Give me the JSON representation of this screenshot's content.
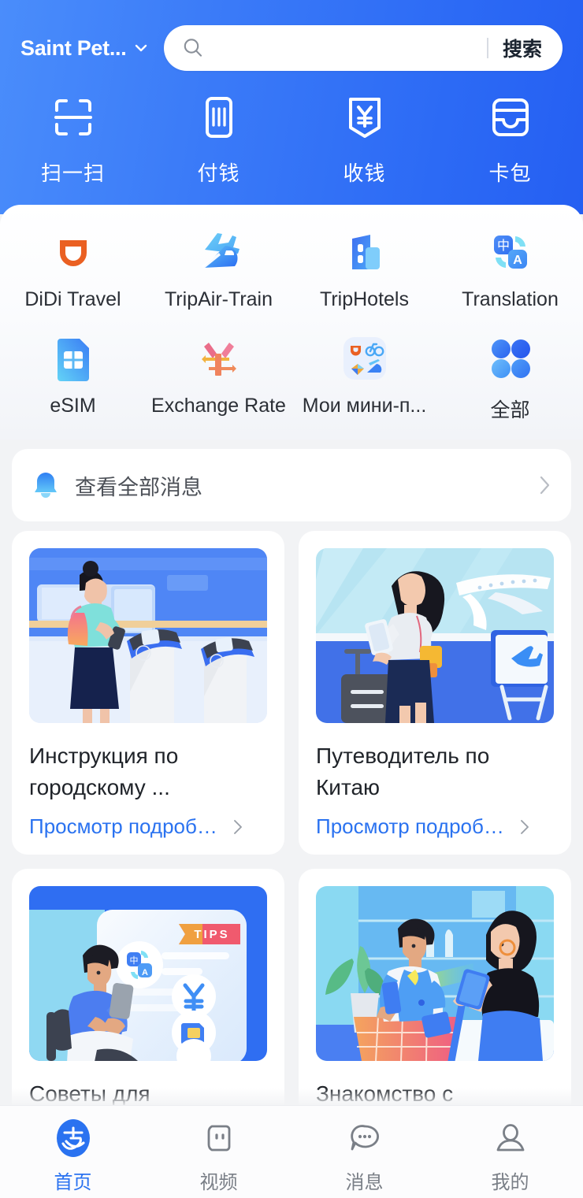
{
  "header": {
    "location": "Saint Pet...",
    "location_icon": "chevron-down-icon",
    "search": {
      "placeholder": "",
      "value": "",
      "icon": "search-icon",
      "button_label": "搜索"
    },
    "quick_actions": [
      {
        "label": "扫一扫",
        "icon": "scan-icon"
      },
      {
        "label": "付钱",
        "icon": "barcode-pay-icon"
      },
      {
        "label": "收钱",
        "icon": "receive-money-icon"
      },
      {
        "label": "卡包",
        "icon": "card-wallet-icon"
      }
    ]
  },
  "apps": {
    "row1": [
      {
        "label": "DiDi Travel",
        "icon": "didi-icon",
        "color": "#ea6022"
      },
      {
        "label": "TripAir-Train",
        "icon": "plane-train-icon",
        "color": "#3a8dfb"
      },
      {
        "label": "TripHotels",
        "icon": "hotel-building-icon",
        "color": "#3a7df5"
      },
      {
        "label": "Translation",
        "icon": "translate-icon",
        "color": "#3b8ef7"
      }
    ],
    "row2": [
      {
        "label": "eSIM",
        "icon": "sim-card-icon",
        "color": "#3d8ef8"
      },
      {
        "label": "Exchange Rate",
        "icon": "exchange-rate-icon",
        "color": "#ef7a6a"
      },
      {
        "label": "Мои мини-п...",
        "icon": "my-miniapps-icon",
        "color": "#e9f0fd"
      },
      {
        "label": "全部",
        "icon": "all-apps-grid-icon",
        "color": "#2f74f2"
      }
    ]
  },
  "notice": {
    "icon": "bell-icon",
    "text": "查看全部消息",
    "chevron": "chevron-right-icon"
  },
  "cards": [
    {
      "title": "Инструкция по городскому ...",
      "link_label": "Просмотр подробн...",
      "link_chevron": "chevron-right-icon",
      "illustration": "metro-gate-woman-phone"
    },
    {
      "title": "Путеводитель по Китаю",
      "link_label": "Просмотр подробн...",
      "link_chevron": "chevron-right-icon",
      "illustration": "airport-woman-suitcase-plane"
    },
    {
      "title": "Советы для",
      "link_label": "",
      "link_chevron": "",
      "illustration": "man-chair-phone-tips"
    },
    {
      "title": "Знакомство с",
      "link_label": "",
      "link_chevron": "",
      "illustration": "shop-checkout-scan"
    }
  ],
  "tabbar": [
    {
      "label": "首页",
      "icon": "alipay-logo-icon",
      "active": true
    },
    {
      "label": "视频",
      "icon": "video-icon",
      "active": false
    },
    {
      "label": "消息",
      "icon": "message-bubble-icon",
      "active": false
    },
    {
      "label": "我的",
      "icon": "profile-person-icon",
      "active": false
    }
  ],
  "colors": {
    "header_gradient_start": "#4a8dfb",
    "header_gradient_end": "#255ff2",
    "accent_blue": "#2a72f0",
    "page_bg": "#f2f3f5",
    "card_bg": "#ffffff",
    "text_primary": "#1f2329",
    "text_secondary": "#7a7f87"
  }
}
